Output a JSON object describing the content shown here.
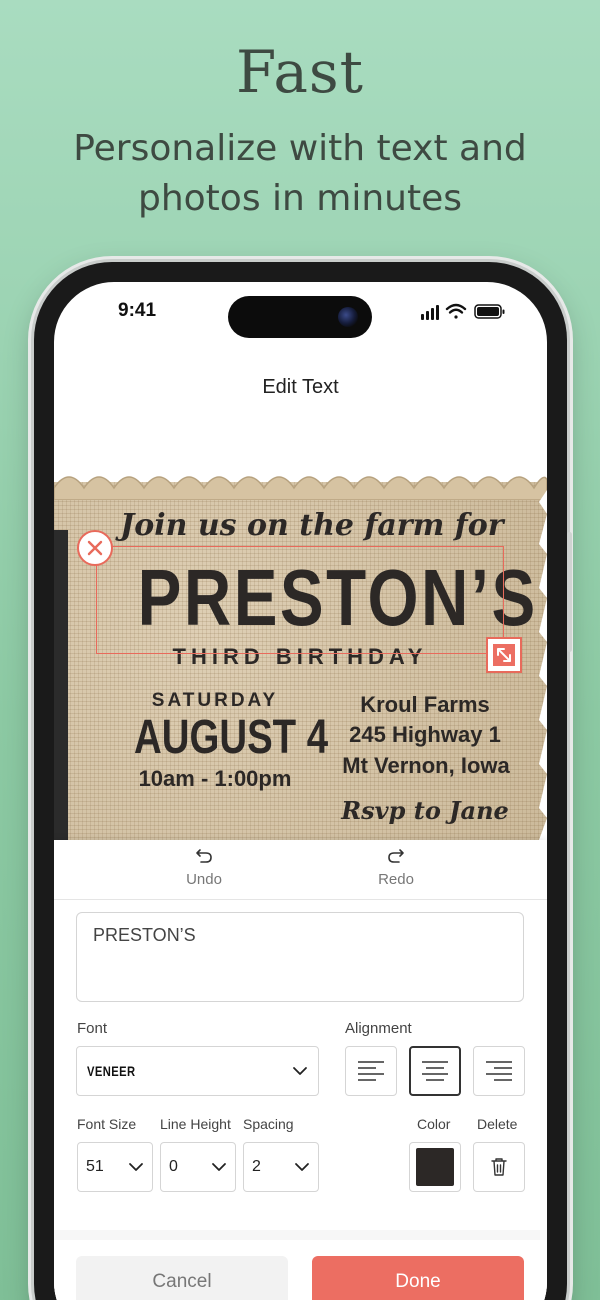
{
  "promo": {
    "headline": "Fast",
    "subline": "Personalize with text and photos in minutes"
  },
  "status_bar": {
    "time": "9:41"
  },
  "nav": {
    "title": "Edit Text"
  },
  "card": {
    "script_line": "Join us on the farm for",
    "name": "PRESTON’S",
    "occasion": "THIRD BIRTHDAY",
    "day": "SATURDAY",
    "date": "AUGUST 4",
    "time": "10am - 1:00pm",
    "venue": "Kroul Farms",
    "address": "245 Highway 1",
    "city": "Mt Vernon, Iowa",
    "rsvp": "Rsvp to Jane"
  },
  "toolbar": {
    "undo_label": "Undo",
    "redo_label": "Redo"
  },
  "editor": {
    "text_value": "PRESTON’S",
    "font_label": "Font",
    "font_value": "VENEER",
    "alignment_label": "Alignment",
    "alignment_selected": "center",
    "font_size_label": "Font Size",
    "font_size_value": "51",
    "line_height_label": "Line Height",
    "line_height_value": "0",
    "spacing_label": "Spacing",
    "spacing_value": "2",
    "color_label": "Color",
    "color_value": "#2c2826",
    "delete_label": "Delete"
  },
  "actions": {
    "cancel_label": "Cancel",
    "done_label": "Done"
  },
  "colors": {
    "background": "#a9dcc0",
    "accent": "#ec6e62",
    "text_ink": "#2c2826"
  }
}
